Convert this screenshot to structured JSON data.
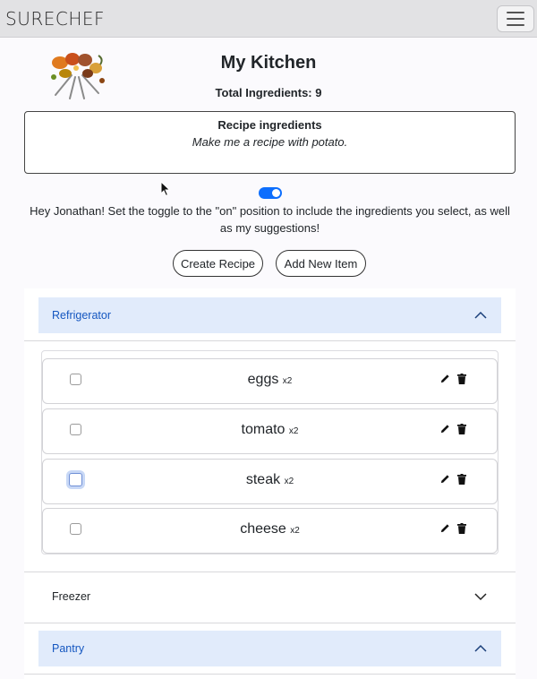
{
  "navbar": {
    "brand": "SURECHEF",
    "menu_icon": "hamburger-menu-icon"
  },
  "logo": {
    "icon": "spoons-of-spices-image"
  },
  "page": {
    "title": "My Kitchen",
    "total": "Total Ingredients: 9"
  },
  "recipe": {
    "title": "Recipe ingredients",
    "text": "Make me a recipe with potato."
  },
  "toggle": {
    "on": true,
    "color": "#0d6efd"
  },
  "helper": "Hey Jonathan! Set the toggle to the \"on\" position to include the ingredients you select, as well as my suggestions!",
  "buttons": {
    "create": "Create Recipe",
    "add": "Add New Item"
  },
  "sections": {
    "refrigerator": {
      "label": "Refrigerator",
      "expanded": true,
      "items": [
        {
          "name": "eggs",
          "qty": "x2",
          "checked": false
        },
        {
          "name": "tomato",
          "qty": "x2",
          "checked": false
        },
        {
          "name": "steak",
          "qty": "x2",
          "checked": false
        },
        {
          "name": "cheese",
          "qty": "x2",
          "checked": false
        }
      ]
    },
    "freezer": {
      "label": "Freezer",
      "expanded": false
    },
    "pantry": {
      "label": "Pantry",
      "expanded": true
    }
  },
  "colors": {
    "accent": "#0d6efd",
    "section_header_bg": "#e1ebfb",
    "section_header_text": "#1557c0"
  }
}
